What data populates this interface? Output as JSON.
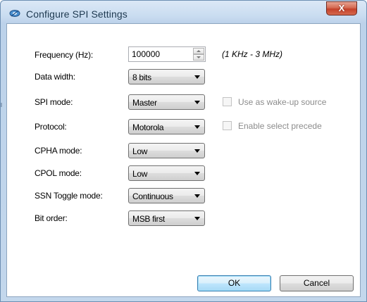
{
  "window": {
    "title": "Configure SPI Settings",
    "close_label": "X"
  },
  "form": {
    "frequency": {
      "label": "Frequency (Hz):",
      "value": "100000",
      "range_hint": "(1 KHz - 3 MHz)"
    },
    "data_width": {
      "label": "Data width:",
      "value": "8 bits"
    },
    "spi_mode": {
      "label": "SPI mode:",
      "value": "Master"
    },
    "protocol": {
      "label": "Protocol:",
      "value": "Motorola"
    },
    "cpha_mode": {
      "label": "CPHA mode:",
      "value": "Low"
    },
    "cpol_mode": {
      "label": "CPOL mode:",
      "value": "Low"
    },
    "ssn_toggle_mode": {
      "label": "SSN Toggle mode:",
      "value": "Continuous"
    },
    "bit_order": {
      "label": "Bit order:",
      "value": "MSB first"
    }
  },
  "options": {
    "wake_up": {
      "label": "Use as wake-up source",
      "checked": false,
      "enabled": false
    },
    "select_precede": {
      "label": "Enable select precede",
      "checked": false,
      "enabled": false
    }
  },
  "buttons": {
    "ok": "OK",
    "cancel": "Cancel"
  },
  "colors": {
    "title_text": "#1e3950",
    "close_button": "#c4412a",
    "frame": "#c3d7ec",
    "disabled_text": "#8c8c8c"
  }
}
